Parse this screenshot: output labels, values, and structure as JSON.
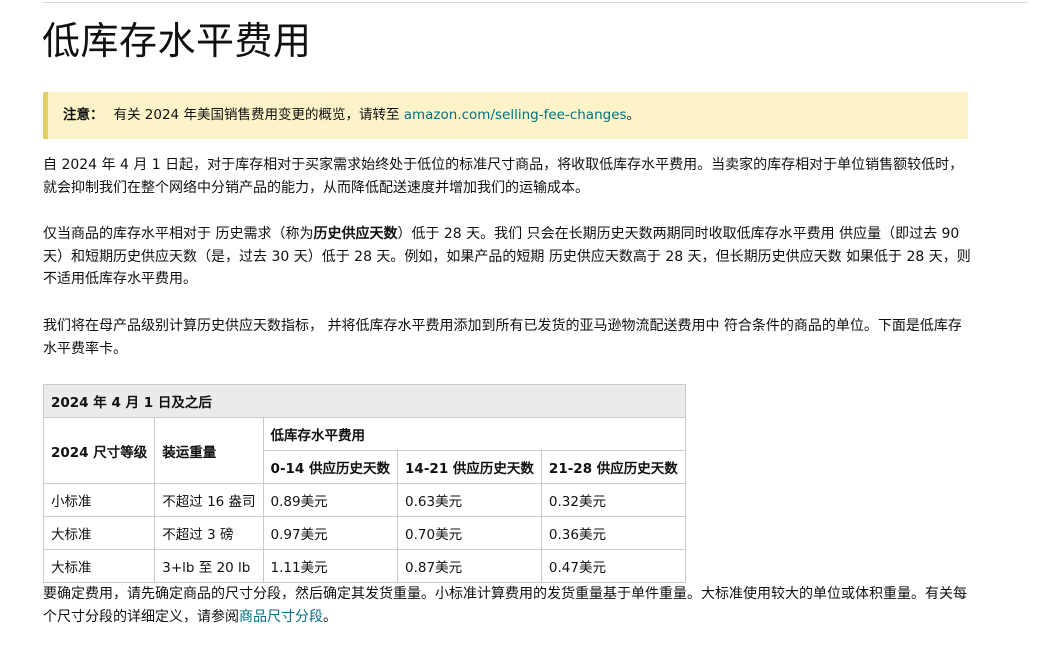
{
  "page": {
    "title": "低库存水平费用"
  },
  "note": {
    "label": "注意：",
    "text_before": "有关 2024 年美国销售费用变更的概览，请转至 ",
    "link_text": "amazon.com/selling-fee-changes",
    "text_after": "。"
  },
  "paragraphs": {
    "p1": "自 2024 年 4 月 1 日起，对于库存相对于买家需求始终处于低位的标准尺寸商品，将收取低库存水平费用。当卖家的库存相对于单位销售额较低时，就会抑制我们在整个网络中分销产品的能力，从而降低配送速度并增加我们的运输成本。",
    "p2_before": "仅当商品的库存水平相对于 历史需求（称为",
    "p2_bold": "历史供应天数",
    "p2_after": "）低于 28 天。我们 只会在长期历史天数两期同时收取低库存水平费用 供应量（即过去 90 天）和短期历史供应天数（是，过去 30 天）低于 28 天。例如，如果产品的短期 历史供应天数高于 28 天，但长期历史供应天数 如果低于 28 天，则不适用低库存水平费用。",
    "p3": "我们将在母产品级别计算历史供应天数指标， 并将低库存水平费用添加到所有已发货的亚马逊物流配送费用中 符合条件的商品的单位。下面是低库存水平费率卡。",
    "p4_before": "要确定费用，请先确定商品的尺寸分段，然后确定其发货重量。小标准计算费用的发货重量基于单件重量。大标准使用较大的单位或体积重量。有关每个尺寸分段的详细定义，请参阅",
    "p4_link": "商品尺寸分段",
    "p4_after": "。"
  },
  "table": {
    "caption": "2024 年 4 月 1 日及之后",
    "col_size_tier": "2024 尺寸等级",
    "col_weight": "装运重量",
    "col_fee_group": "低库存水平费用",
    "col_fee_1": "0-14 供应历史天数",
    "col_fee_2": "14-21 供应历史天数",
    "col_fee_3": "21-28 供应历史天数",
    "rows": [
      {
        "tier": "小标准",
        "weight": "不超过 16 盎司",
        "f1": "0.89美元",
        "f2": "0.63美元",
        "f3": "0.32美元"
      },
      {
        "tier": "大标准",
        "weight": "不超过 3 磅",
        "f1": "0.97美元",
        "f2": "0.70美元",
        "f3": "0.36美元"
      },
      {
        "tier": "大标准",
        "weight": "3+lb 至 20 lb",
        "f1": "1.11美元",
        "f2": "0.87美元",
        "f3": "0.47美元"
      }
    ]
  }
}
